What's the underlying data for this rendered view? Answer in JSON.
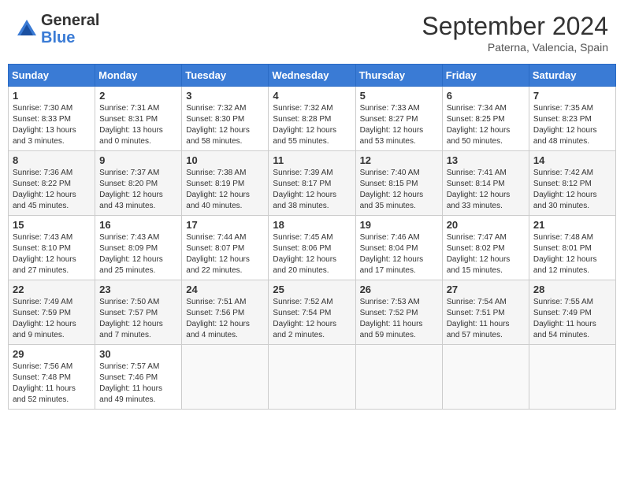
{
  "logo": {
    "general": "General",
    "blue": "Blue"
  },
  "title": "September 2024",
  "location": "Paterna, Valencia, Spain",
  "headers": [
    "Sunday",
    "Monday",
    "Tuesday",
    "Wednesday",
    "Thursday",
    "Friday",
    "Saturday"
  ],
  "weeks": [
    [
      {
        "day": "1",
        "sunrise": "Sunrise: 7:30 AM",
        "sunset": "Sunset: 8:33 PM",
        "daylight": "Daylight: 13 hours and 3 minutes."
      },
      {
        "day": "2",
        "sunrise": "Sunrise: 7:31 AM",
        "sunset": "Sunset: 8:31 PM",
        "daylight": "Daylight: 13 hours and 0 minutes."
      },
      {
        "day": "3",
        "sunrise": "Sunrise: 7:32 AM",
        "sunset": "Sunset: 8:30 PM",
        "daylight": "Daylight: 12 hours and 58 minutes."
      },
      {
        "day": "4",
        "sunrise": "Sunrise: 7:32 AM",
        "sunset": "Sunset: 8:28 PM",
        "daylight": "Daylight: 12 hours and 55 minutes."
      },
      {
        "day": "5",
        "sunrise": "Sunrise: 7:33 AM",
        "sunset": "Sunset: 8:27 PM",
        "daylight": "Daylight: 12 hours and 53 minutes."
      },
      {
        "day": "6",
        "sunrise": "Sunrise: 7:34 AM",
        "sunset": "Sunset: 8:25 PM",
        "daylight": "Daylight: 12 hours and 50 minutes."
      },
      {
        "day": "7",
        "sunrise": "Sunrise: 7:35 AM",
        "sunset": "Sunset: 8:23 PM",
        "daylight": "Daylight: 12 hours and 48 minutes."
      }
    ],
    [
      {
        "day": "8",
        "sunrise": "Sunrise: 7:36 AM",
        "sunset": "Sunset: 8:22 PM",
        "daylight": "Daylight: 12 hours and 45 minutes."
      },
      {
        "day": "9",
        "sunrise": "Sunrise: 7:37 AM",
        "sunset": "Sunset: 8:20 PM",
        "daylight": "Daylight: 12 hours and 43 minutes."
      },
      {
        "day": "10",
        "sunrise": "Sunrise: 7:38 AM",
        "sunset": "Sunset: 8:19 PM",
        "daylight": "Daylight: 12 hours and 40 minutes."
      },
      {
        "day": "11",
        "sunrise": "Sunrise: 7:39 AM",
        "sunset": "Sunset: 8:17 PM",
        "daylight": "Daylight: 12 hours and 38 minutes."
      },
      {
        "day": "12",
        "sunrise": "Sunrise: 7:40 AM",
        "sunset": "Sunset: 8:15 PM",
        "daylight": "Daylight: 12 hours and 35 minutes."
      },
      {
        "day": "13",
        "sunrise": "Sunrise: 7:41 AM",
        "sunset": "Sunset: 8:14 PM",
        "daylight": "Daylight: 12 hours and 33 minutes."
      },
      {
        "day": "14",
        "sunrise": "Sunrise: 7:42 AM",
        "sunset": "Sunset: 8:12 PM",
        "daylight": "Daylight: 12 hours and 30 minutes."
      }
    ],
    [
      {
        "day": "15",
        "sunrise": "Sunrise: 7:43 AM",
        "sunset": "Sunset: 8:10 PM",
        "daylight": "Daylight: 12 hours and 27 minutes."
      },
      {
        "day": "16",
        "sunrise": "Sunrise: 7:43 AM",
        "sunset": "Sunset: 8:09 PM",
        "daylight": "Daylight: 12 hours and 25 minutes."
      },
      {
        "day": "17",
        "sunrise": "Sunrise: 7:44 AM",
        "sunset": "Sunset: 8:07 PM",
        "daylight": "Daylight: 12 hours and 22 minutes."
      },
      {
        "day": "18",
        "sunrise": "Sunrise: 7:45 AM",
        "sunset": "Sunset: 8:06 PM",
        "daylight": "Daylight: 12 hours and 20 minutes."
      },
      {
        "day": "19",
        "sunrise": "Sunrise: 7:46 AM",
        "sunset": "Sunset: 8:04 PM",
        "daylight": "Daylight: 12 hours and 17 minutes."
      },
      {
        "day": "20",
        "sunrise": "Sunrise: 7:47 AM",
        "sunset": "Sunset: 8:02 PM",
        "daylight": "Daylight: 12 hours and 15 minutes."
      },
      {
        "day": "21",
        "sunrise": "Sunrise: 7:48 AM",
        "sunset": "Sunset: 8:01 PM",
        "daylight": "Daylight: 12 hours and 12 minutes."
      }
    ],
    [
      {
        "day": "22",
        "sunrise": "Sunrise: 7:49 AM",
        "sunset": "Sunset: 7:59 PM",
        "daylight": "Daylight: 12 hours and 9 minutes."
      },
      {
        "day": "23",
        "sunrise": "Sunrise: 7:50 AM",
        "sunset": "Sunset: 7:57 PM",
        "daylight": "Daylight: 12 hours and 7 minutes."
      },
      {
        "day": "24",
        "sunrise": "Sunrise: 7:51 AM",
        "sunset": "Sunset: 7:56 PM",
        "daylight": "Daylight: 12 hours and 4 minutes."
      },
      {
        "day": "25",
        "sunrise": "Sunrise: 7:52 AM",
        "sunset": "Sunset: 7:54 PM",
        "daylight": "Daylight: 12 hours and 2 minutes."
      },
      {
        "day": "26",
        "sunrise": "Sunrise: 7:53 AM",
        "sunset": "Sunset: 7:52 PM",
        "daylight": "Daylight: 11 hours and 59 minutes."
      },
      {
        "day": "27",
        "sunrise": "Sunrise: 7:54 AM",
        "sunset": "Sunset: 7:51 PM",
        "daylight": "Daylight: 11 hours and 57 minutes."
      },
      {
        "day": "28",
        "sunrise": "Sunrise: 7:55 AM",
        "sunset": "Sunset: 7:49 PM",
        "daylight": "Daylight: 11 hours and 54 minutes."
      }
    ],
    [
      {
        "day": "29",
        "sunrise": "Sunrise: 7:56 AM",
        "sunset": "Sunset: 7:48 PM",
        "daylight": "Daylight: 11 hours and 52 minutes."
      },
      {
        "day": "30",
        "sunrise": "Sunrise: 7:57 AM",
        "sunset": "Sunset: 7:46 PM",
        "daylight": "Daylight: 11 hours and 49 minutes."
      },
      null,
      null,
      null,
      null,
      null
    ]
  ]
}
